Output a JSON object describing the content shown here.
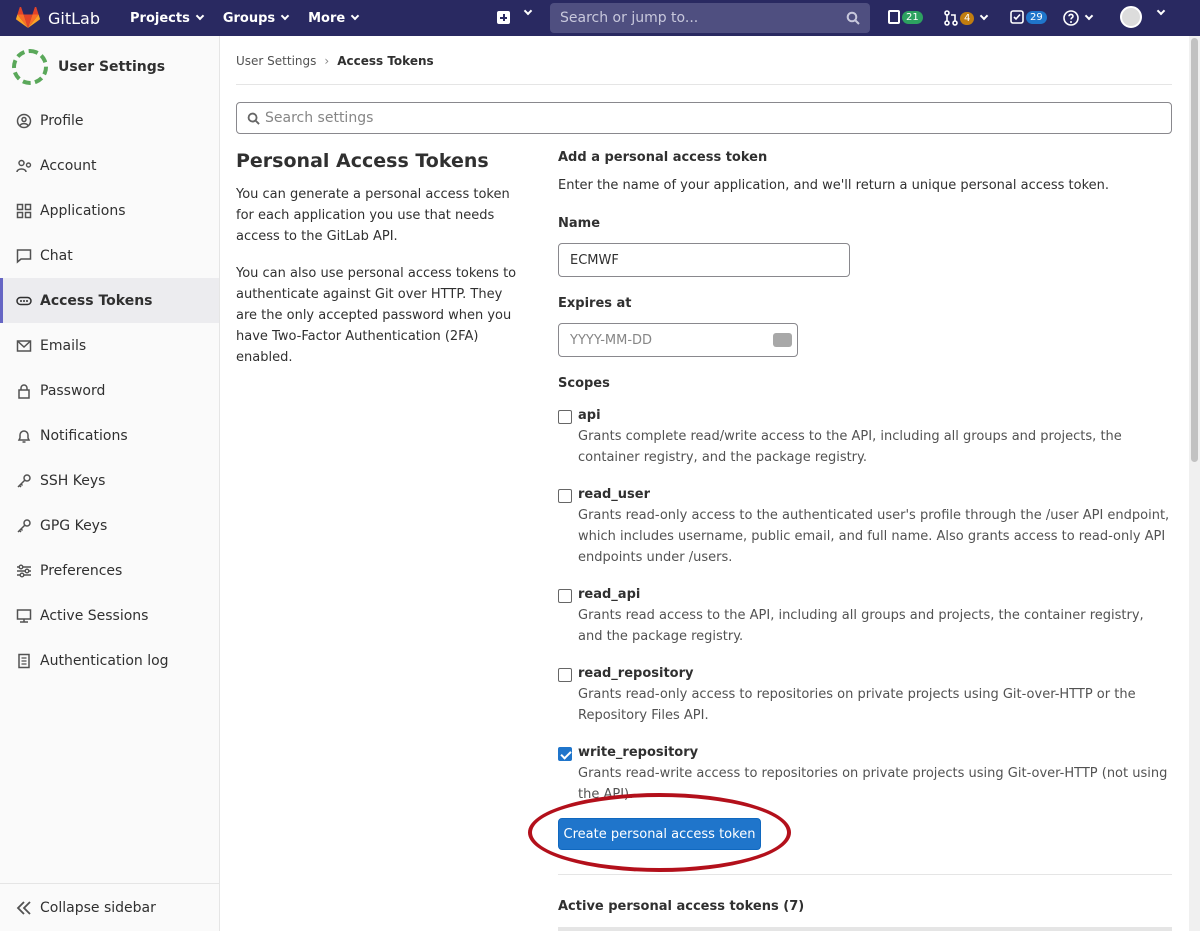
{
  "navbar": {
    "brand": "GitLab",
    "menu": [
      "Projects",
      "Groups",
      "More"
    ],
    "search_placeholder": "Search or jump to...",
    "issues_count": "21",
    "mr_count": "4",
    "todos_count": "29"
  },
  "sidebar": {
    "title": "User Settings",
    "items": [
      {
        "label": "Profile",
        "icon": "profile-icon"
      },
      {
        "label": "Account",
        "icon": "account-icon"
      },
      {
        "label": "Applications",
        "icon": "applications-icon"
      },
      {
        "label": "Chat",
        "icon": "chat-icon"
      },
      {
        "label": "Access Tokens",
        "icon": "token-icon",
        "active": true
      },
      {
        "label": "Emails",
        "icon": "email-icon"
      },
      {
        "label": "Password",
        "icon": "lock-icon"
      },
      {
        "label": "Notifications",
        "icon": "bell-icon"
      },
      {
        "label": "SSH Keys",
        "icon": "key-icon"
      },
      {
        "label": "GPG Keys",
        "icon": "key-icon"
      },
      {
        "label": "Preferences",
        "icon": "preferences-icon"
      },
      {
        "label": "Active Sessions",
        "icon": "monitor-icon"
      },
      {
        "label": "Authentication log",
        "icon": "log-icon"
      }
    ],
    "collapse": "Collapse sidebar"
  },
  "breadcrumb": {
    "parent": "User Settings",
    "current": "Access Tokens"
  },
  "settings_search": {
    "placeholder": "Search settings"
  },
  "intro": {
    "title": "Personal Access Tokens",
    "p1": "You can generate a personal access token for each application you use that needs access to the GitLab API.",
    "p2": "You can also use personal access tokens to authenticate against Git over HTTP. They are the only accepted password when you have Two-Factor Authentication (2FA) enabled."
  },
  "form": {
    "heading": "Add a personal access token",
    "subheading": "Enter the name of your application, and we'll return a unique personal access token.",
    "name_label": "Name",
    "name_value": "ECMWF",
    "expires_label": "Expires at",
    "expires_placeholder": "YYYY-MM-DD",
    "scopes_label": "Scopes",
    "scopes": [
      {
        "name": "api",
        "checked": false,
        "desc": "Grants complete read/write access to the API, including all groups and projects, the container registry, and the package registry."
      },
      {
        "name": "read_user",
        "checked": false,
        "desc": "Grants read-only access to the authenticated user's profile through the /user API endpoint, which includes username, public email, and full name. Also grants access to read-only API endpoints under /users."
      },
      {
        "name": "read_api",
        "checked": false,
        "desc": "Grants read access to the API, including all groups and projects, the container registry, and the package registry."
      },
      {
        "name": "read_repository",
        "checked": false,
        "desc": "Grants read-only access to repositories on private projects using Git-over-HTTP or the Repository Files API."
      },
      {
        "name": "write_repository",
        "checked": true,
        "desc": "Grants read-write access to repositories on private projects using Git-over-HTTP (not using the API)."
      }
    ],
    "submit_label": "Create personal access token"
  },
  "active_tokens_title": "Active personal access tokens (7)"
}
